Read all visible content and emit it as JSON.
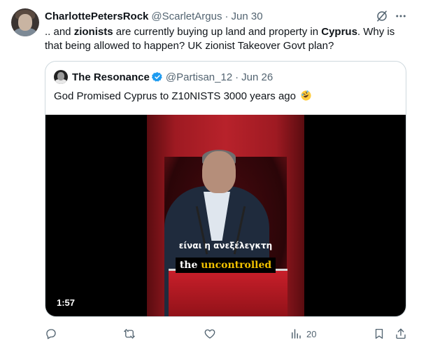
{
  "tweet": {
    "author_name": "CharlottePetersRock",
    "author_handle": "@ScarletArgus",
    "separator": "·",
    "date": "Jun 30",
    "text_parts": [
      {
        "text": ".. and ",
        "bold": false
      },
      {
        "text": "zionists",
        "bold": true
      },
      {
        "text": " are currently buying up land and property in ",
        "bold": false
      },
      {
        "text": "Cyprus",
        "bold": true
      },
      {
        "text": ". Why is that being allowed to happen? UK zionist Takeover Govt plan?",
        "bold": false
      }
    ]
  },
  "quote": {
    "author_name": "The Resonance",
    "author_handle": "@Partisan_12",
    "separator": "·",
    "date": "Jun 26",
    "text": "God Promised Cyprus to Z10NISTS 3000 years ago",
    "emoji": "rolling-on-floor-laughing",
    "video": {
      "subtitle_greek": "είναι η ανεξέλεγκτη",
      "subtitle_english_prefix": "the ",
      "subtitle_english_highlight": "uncontrolled",
      "duration": "1:57"
    }
  },
  "actions": {
    "reply_icon": "reply-icon",
    "retweet_icon": "retweet-icon",
    "like_icon": "like-icon",
    "views_icon": "views-icon",
    "views_count": "20",
    "bookmark_icon": "bookmark-icon",
    "share_icon": "share-icon"
  },
  "colors": {
    "text_primary": "#0f1419",
    "text_secondary": "#536471",
    "verified_blue": "#1d9bf0",
    "border": "#cfd9de",
    "subtitle_highlight": "#f0c000"
  }
}
